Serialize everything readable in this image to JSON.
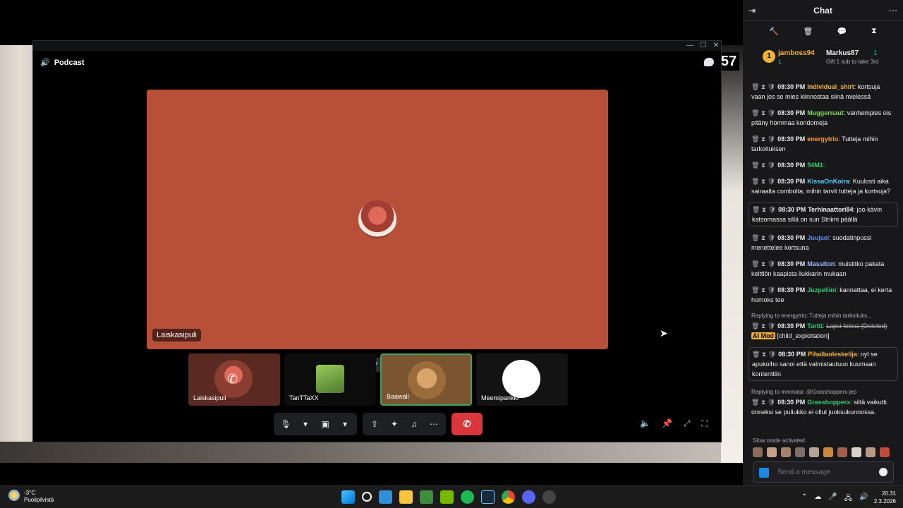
{
  "stream": {
    "counter": "57"
  },
  "discord": {
    "window_controls": {
      "minimize": "—",
      "maximize": "☐",
      "close": "✕"
    },
    "channel": "Podcast",
    "stage": {
      "name": "Laiskasipuli"
    },
    "participants": [
      {
        "name": "Laiskasipuli"
      },
      {
        "name": "TanTTaXX"
      },
      {
        "name": "Baawali"
      },
      {
        "name": "Meemipankki"
      }
    ],
    "controls": {
      "mic": "🎙",
      "dropdown1": "▾",
      "camera": "▣",
      "dropdown2": "▾",
      "screenshare": "⇪",
      "activities": "✦",
      "soundboard": "♫",
      "more": "⋯",
      "hangup": "✆"
    },
    "right_controls": [
      "🔈",
      "📌",
      "⤢",
      "⛶"
    ]
  },
  "chat": {
    "title": "Chat",
    "header_left_icon": "⇥",
    "header_right_icon": "⋯",
    "mod_tools": [
      "🔨",
      "🗑",
      "💬",
      "⧗"
    ],
    "leaderboard": {
      "first": {
        "rank": "1",
        "name": "jamboss94",
        "count": "1"
      },
      "second": {
        "name": "Markus87",
        "count": "1"
      },
      "gift_hint": "Gift 1 sub to take 3rd"
    },
    "messages": [
      {
        "time": "08:30 PM",
        "user": "Individual_shirt",
        "color": "#f0b232",
        "text": "kortsuja vaan jos se mies kiinnostaa siinä mielessä",
        "highlight": false
      },
      {
        "time": "08:30 PM",
        "user": "Muggernaut",
        "color": "#7ed957",
        "text": "vanhempies ois pitäny hommaa kondomeja",
        "highlight": false
      },
      {
        "time": "08:30 PM",
        "user": "energytrio",
        "color": "#ff9f1c",
        "text": "Tutteja mihin tarkoituksen",
        "highlight": false
      },
      {
        "time": "08:30 PM",
        "user": "54M1",
        "color": "#2ecc71",
        "text": "",
        "highlight": false
      },
      {
        "time": "08:30 PM",
        "user": "KissaOnKoira",
        "color": "#4fd1ff",
        "text": "Kuulosti aika sairaalta combolta, mihin tarvit tutteja ja kortsuja?",
        "highlight": false
      },
      {
        "time": "08:30 PM",
        "user": "Terhinaattori84",
        "color": "#efeff1",
        "text": "joo kävin katsomassa sillä on sun Striimi päällä",
        "highlight": true
      },
      {
        "time": "08:30 PM",
        "user": "Juujaei",
        "color": "#5b8def",
        "text": "suodatinpussi menettelee kortsuna",
        "highlight": false
      },
      {
        "time": "08:30 PM",
        "user": "Massiton",
        "color": "#9fb7ff",
        "text": "muistitko pakata keittiön kaapista liukkarin mukaan",
        "highlight": false
      },
      {
        "time": "08:30 PM",
        "user": "Juzpeliini",
        "color": "#2ecc71",
        "text": "kannattaa, ei kerta homoks tee",
        "highlight": false
      },
      {
        "reply": "Replying to energytrio: Tutteja mihin tarkoituks...",
        "time": "08:30 PM",
        "user": "Tartti",
        "color": "#2ecc71",
        "deleted": "Lapsi fetissi (Deleted)",
        "tag": "AI Mod",
        "text": "[child_exploitation]",
        "highlight": false
      },
      {
        "time": "08:30 PM",
        "user": "Pihallaoleskelija",
        "color": "#f0b232",
        "text": "nyt se apukolho sanoi että valmistautuun kuumaan kontenttiin",
        "highlight": true
      },
      {
        "reply": "Replying to mmmata: @Grasshopperx jep",
        "time": "08:30 PM",
        "user": "Grasshopperx",
        "color": "#2ecc71",
        "text": "siltä vaikutti. onneksi se puliukko ei ollut juoksukunnossa.",
        "highlight": false
      }
    ],
    "slow_mode": "Slow mode activated",
    "input_placeholder": "Send a message"
  },
  "taskbar": {
    "weather_temp": "-3°C",
    "weather_desc": "Puolipilvistä",
    "time": "20.31",
    "date": "2.3.2026",
    "tray": [
      "⌃",
      "☁",
      "🎤",
      "🖧",
      "🔊"
    ]
  }
}
